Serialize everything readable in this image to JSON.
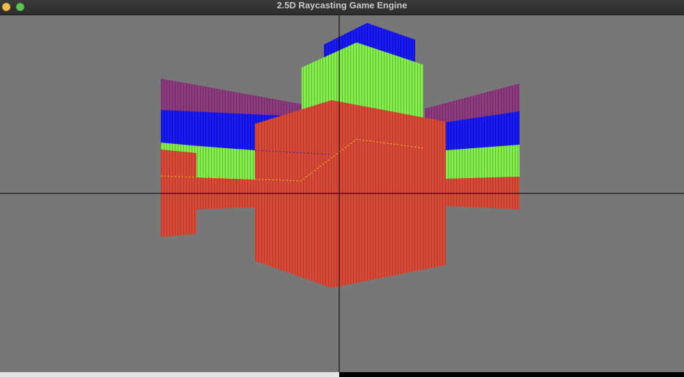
{
  "window": {
    "title": "2.5D Raycasting Game Engine",
    "buttons": [
      "close-button",
      "zoom-button"
    ]
  },
  "viewport": {
    "background_color": "#777777",
    "crosshair_color": "#000000",
    "wall_colors": {
      "red": "#d84a35",
      "green": "#84ee4c",
      "blue": "#1a1af2",
      "purple": "#8c3c7e"
    }
  }
}
